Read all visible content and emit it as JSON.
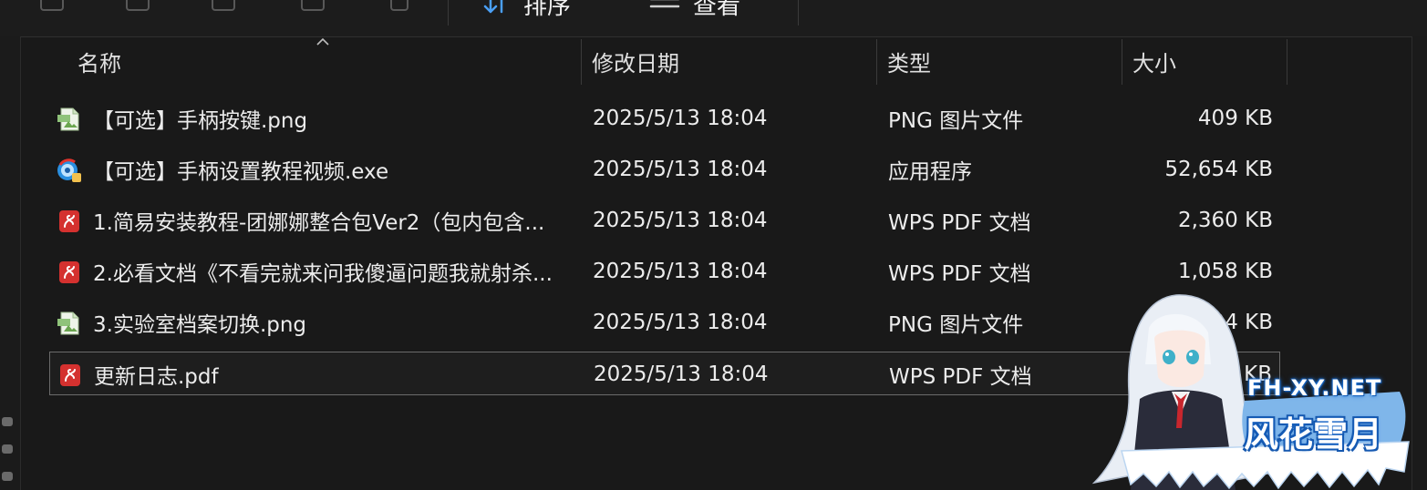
{
  "command_bar": {
    "sort_label": "排序",
    "view_label": "查看",
    "icons": [
      "copy-icon",
      "paste-icon",
      "rename-icon",
      "share-icon",
      "delete-icon",
      "sort-icon",
      "view-icon"
    ]
  },
  "columns": {
    "name": "名称",
    "date": "修改日期",
    "type": "类型",
    "size": "大小"
  },
  "files": [
    {
      "name": "【可选】手柄按键.png",
      "date": "2025/5/13 18:04",
      "type": "PNG 图片文件",
      "size": "409 KB",
      "icon": "png-file-icon"
    },
    {
      "name": "【可选】手柄设置教程视频.exe",
      "date": "2025/5/13 18:04",
      "type": "应用程序",
      "size": "52,654 KB",
      "icon": "exe-file-icon"
    },
    {
      "name": "1.简易安装教程-团娜娜整合包Ver2（包内包含...",
      "date": "2025/5/13 18:04",
      "type": "WPS PDF 文档",
      "size": "2,360 KB",
      "icon": "pdf-file-icon"
    },
    {
      "name": "2.必看文档《不看完就来问我傻逼问题我就射杀...",
      "date": "2025/5/13 18:04",
      "type": "WPS PDF 文档",
      "size": "1,058 KB",
      "icon": "pdf-file-icon"
    },
    {
      "name": "3.实验室档案切换.png",
      "date": "2025/5/13 18:04",
      "type": "PNG 图片文件",
      "size": "424 KB",
      "icon": "png-file-icon"
    },
    {
      "name": "更新日志.pdf",
      "date": "2025/5/13 18:04",
      "type": "WPS PDF 文档",
      "size": "302 KB",
      "icon": "pdf-file-icon"
    }
  ],
  "watermark": {
    "site": "FH-XY.NET",
    "name": "风花雪月"
  },
  "colors": {
    "background": "#191919",
    "text": "#e6e6e6",
    "pdf_red": "#d4312f",
    "png_green": "#8fc37a",
    "accent_blue": "#4a9ff5"
  }
}
